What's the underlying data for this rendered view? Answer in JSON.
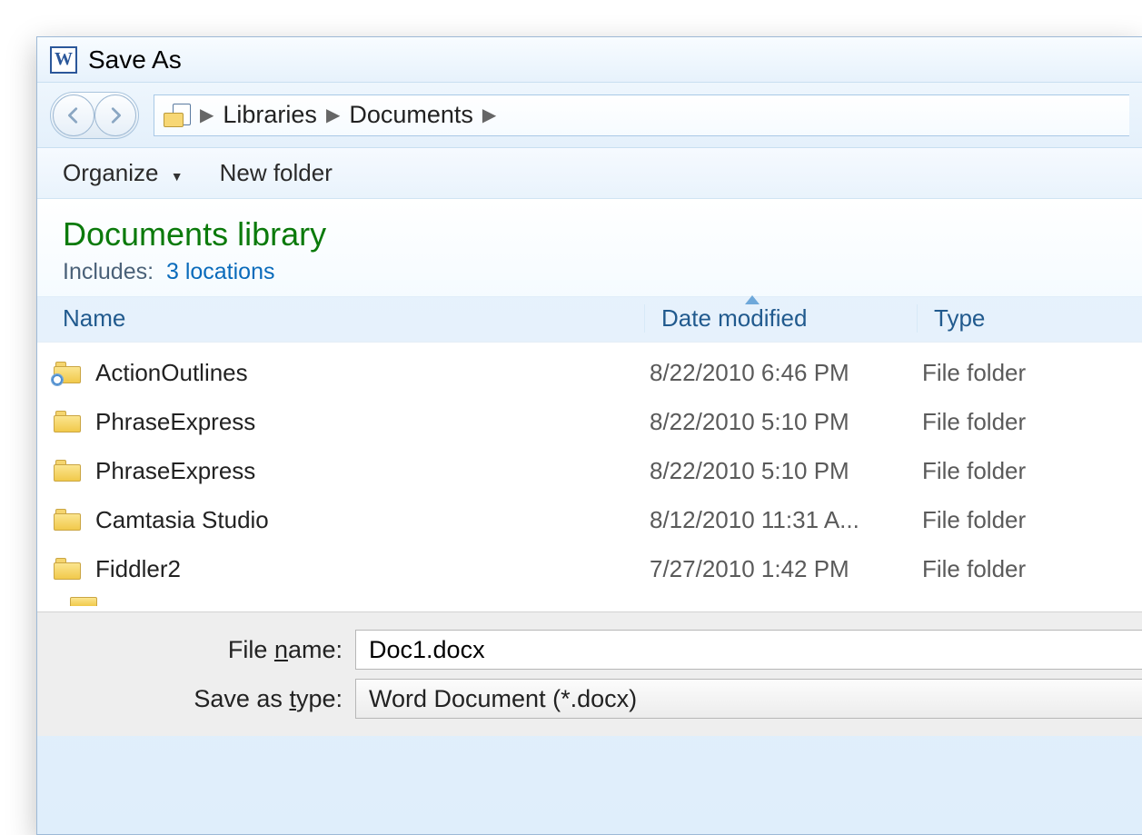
{
  "window": {
    "title": "Save As"
  },
  "breadcrumb": {
    "items": [
      "Libraries",
      "Documents"
    ]
  },
  "toolbar": {
    "organize": "Organize",
    "new_folder": "New folder"
  },
  "library": {
    "heading": "Documents library",
    "includes_label": "Includes:",
    "locations_link": "3 locations"
  },
  "columns": {
    "name": "Name",
    "date": "Date modified",
    "type": "Type"
  },
  "files": [
    {
      "name": "ActionOutlines",
      "date": "8/22/2010 6:46 PM",
      "type": "File folder",
      "shortcut": true
    },
    {
      "name": "PhraseExpress",
      "date": "8/22/2010 5:10 PM",
      "type": "File folder",
      "shortcut": false
    },
    {
      "name": "PhraseExpress",
      "date": "8/22/2010 5:10 PM",
      "type": "File folder",
      "shortcut": false
    },
    {
      "name": "Camtasia Studio",
      "date": "8/12/2010 11:31 A...",
      "type": "File folder",
      "shortcut": false
    },
    {
      "name": "Fiddler2",
      "date": "7/27/2010 1:42 PM",
      "type": "File folder",
      "shortcut": false
    }
  ],
  "form": {
    "filename_label_pre": "File ",
    "filename_label_ul": "n",
    "filename_label_post": "ame:",
    "filename_value": "Doc1.docx",
    "type_label_pre": "Save as ",
    "type_label_ul": "t",
    "type_label_post": "ype:",
    "type_value": "Word Document (*.docx)"
  }
}
